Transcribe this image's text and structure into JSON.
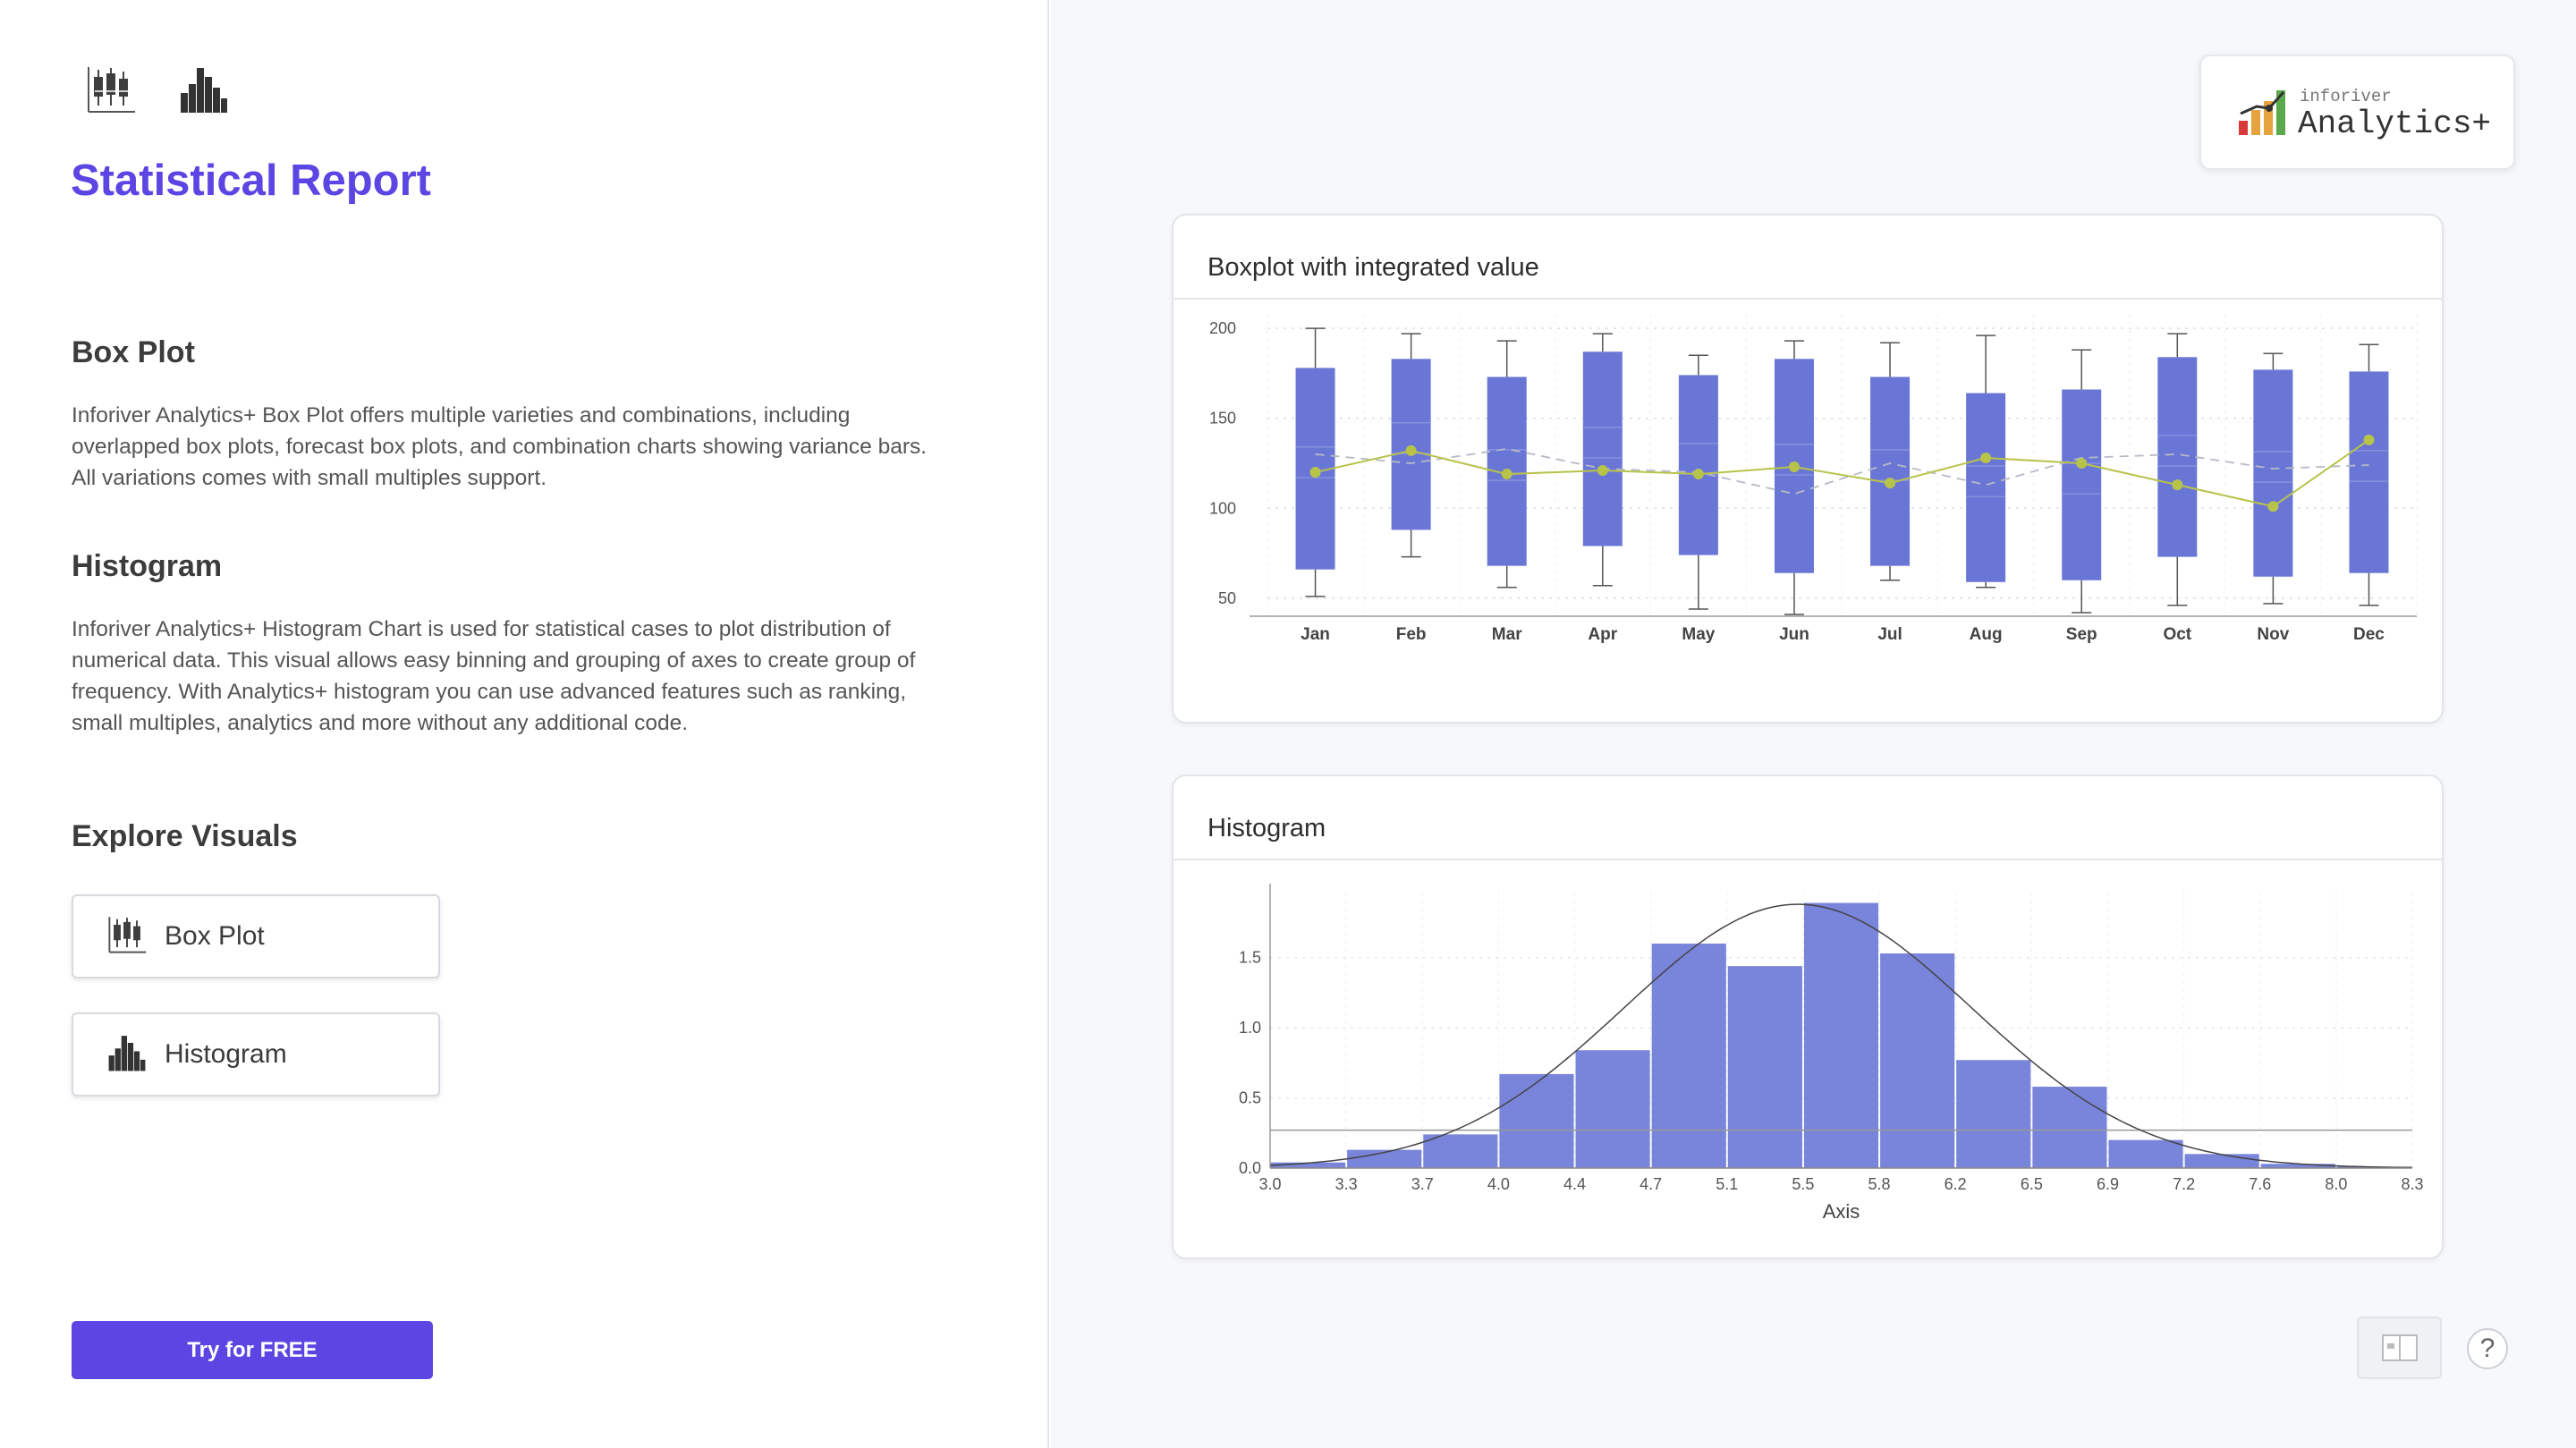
{
  "report": {
    "title": "Statistical Report"
  },
  "sections": [
    {
      "heading": "Box Plot",
      "text": "Inforiver Analytics+ Box Plot offers multiple varieties and combinations, including overlapped box plots, forecast box plots, and combination charts showing variance bars. All variations comes with small multiples support."
    },
    {
      "heading": "Histogram",
      "text": "Inforiver Analytics+ Histogram Chart is used for statistical cases to plot distribution of numerical data. This visual allows easy binning and grouping of axes to create group of frequency. With Analytics+ histogram you can use advanced features such as ranking, small multiples, analytics and more without any additional code."
    }
  ],
  "explore": {
    "heading": "Explore Visuals",
    "buttons": [
      {
        "label": "Box Plot",
        "icon": "boxplot-icon"
      },
      {
        "label": "Histogram",
        "icon": "histogram-icon"
      }
    ]
  },
  "cta": {
    "label": "Try for FREE"
  },
  "logo": {
    "small": "inforiver",
    "big": "Analytics+"
  },
  "colors": {
    "accent": "#5b46e3",
    "bar": "#6a76d6",
    "line": "#b8c34a"
  },
  "chart_data": [
    {
      "type": "boxplot",
      "title": "Boxplot with integrated value",
      "categories": [
        "Jan",
        "Feb",
        "Mar",
        "Apr",
        "May",
        "Jun",
        "Jul",
        "Aug",
        "Sep",
        "Oct",
        "Nov",
        "Dec"
      ],
      "whisker_low": [
        51,
        73,
        56,
        57,
        44,
        41,
        60,
        56,
        42,
        46,
        47,
        46
      ],
      "q1": [
        66,
        88,
        68,
        79,
        74,
        64,
        68,
        59,
        60,
        73,
        62,
        64
      ],
      "q3": [
        178,
        183,
        173,
        187,
        174,
        183,
        173,
        164,
        166,
        184,
        177,
        176
      ],
      "whisker_high": [
        200,
        197,
        193,
        197,
        185,
        193,
        192,
        196,
        188,
        197,
        186,
        191
      ],
      "integrated_value": [
        120,
        132,
        119,
        121,
        119,
        123,
        114,
        128,
        125,
        113,
        101,
        138
      ],
      "comparison": [
        130,
        125,
        133,
        122,
        120,
        108,
        125,
        113,
        128,
        130,
        122,
        124
      ],
      "y_ticks": [
        50,
        100,
        150,
        200
      ],
      "ylim": [
        40,
        208
      ],
      "grid": true
    },
    {
      "type": "histogram",
      "title": "Histogram",
      "xlabel": "Axis",
      "x_ticks": [
        "3.0",
        "3.3",
        "3.7",
        "4.0",
        "4.4",
        "4.7",
        "5.1",
        "5.5",
        "5.8",
        "6.2",
        "6.5",
        "6.9",
        "7.2",
        "7.6",
        "8.0",
        "8.3"
      ],
      "values": [
        0.04,
        0.13,
        0.24,
        0.67,
        0.84,
        1.6,
        1.44,
        1.89,
        1.53,
        0.77,
        0.58,
        0.2,
        0.1,
        0.03,
        0.01
      ],
      "y_ticks": [
        "0.0",
        "0.5",
        "1.0",
        "1.5"
      ],
      "ylim": [
        0,
        1.9
      ],
      "mean_line": 0.27,
      "grid": true
    }
  ]
}
